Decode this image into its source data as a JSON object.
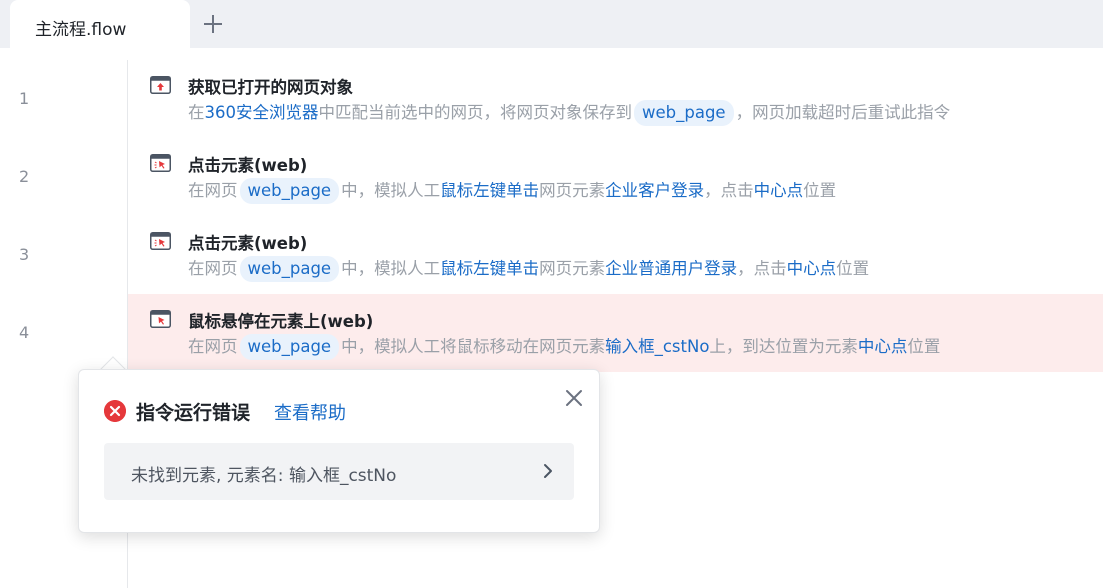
{
  "tabs": [
    {
      "label": "主流程.flow"
    }
  ],
  "line_numbers": [
    "1",
    "2",
    "3",
    "4"
  ],
  "steps": [
    {
      "title": "获取已打开的网页对象",
      "icon": "open-webpage-icon",
      "desc": {
        "p1": "在",
        "browser": "360安全浏览器",
        "p2": "中匹配当前选中的网页，将网页对象保存到",
        "var": "web_page",
        "p3": "，网页加载超时后重试此指令"
      }
    },
    {
      "title": "点击元素(web)",
      "icon": "click-element-icon",
      "desc": {
        "p1": "在网页",
        "var": "web_page",
        "p2": "中，模拟人工",
        "action": "鼠标左键单击",
        "p3": "网页元素",
        "element": "企业客户登录",
        "p4": "，点击",
        "point": "中心点",
        "p5": "位置"
      }
    },
    {
      "title": "点击元素(web)",
      "icon": "click-element-icon",
      "desc": {
        "p1": "在网页",
        "var": "web_page",
        "p2": "中，模拟人工",
        "action": "鼠标左键单击",
        "p3": "网页元素",
        "element": "企业普通用户登录",
        "p4": "，点击",
        "point": "中心点",
        "p5": "位置"
      }
    },
    {
      "title": "鼠标悬停在元素上(web)",
      "icon": "hover-element-icon",
      "status": "error",
      "desc": {
        "p1": "在网页",
        "var": "web_page",
        "p2": "中，模拟人工将鼠标移动在网页元素",
        "element": "输入框_cstNo",
        "p3": "上，到达位置为元素",
        "point": "中心点",
        "p4": "位置"
      }
    }
  ],
  "error_popup": {
    "title": "指令运行错误",
    "help_link": "查看帮助",
    "message": "未找到元素, 元素名: 输入框_cstNo"
  },
  "colors": {
    "accent": "#1b6cc7",
    "error": "#e5383b",
    "error_bg": "#fdecec"
  }
}
